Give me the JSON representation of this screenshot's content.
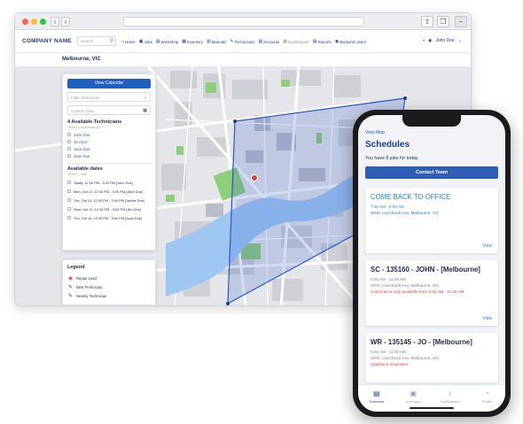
{
  "browser": {
    "company": "COMPANY NAME",
    "search_placeholder": "Search",
    "menu": [
      {
        "icon": "home-icon",
        "glyph": "⌂",
        "label": "Home"
      },
      {
        "icon": "briefcase-icon",
        "glyph": "▣",
        "label": "Jobs"
      },
      {
        "icon": "workshop-icon",
        "glyph": "▤",
        "label": "Workshop"
      },
      {
        "icon": "inventory-icon",
        "glyph": "▦",
        "label": "Inventory"
      },
      {
        "icon": "manuals-icon",
        "glyph": "▥",
        "label": "Manuals"
      },
      {
        "icon": "wrench-icon",
        "glyph": "✎",
        "label": "Technicians"
      },
      {
        "icon": "accounts-icon",
        "glyph": "▧",
        "label": "Accounts"
      },
      {
        "icon": "dashboard-icon",
        "glyph": "▦",
        "label": "Dashboards"
      },
      {
        "icon": "reports-icon",
        "glyph": "▤",
        "label": "Reports"
      },
      {
        "icon": "user-circle-icon",
        "glyph": "◉",
        "label": "Backend Users"
      }
    ],
    "user_name": "John Doe",
    "location": "Melbourne, VIC"
  },
  "panel": {
    "view_calendar": "View Calendar",
    "filter_placeholder": "Filter Technician",
    "date_placeholder": "Custom Date",
    "available_title": "4 Available Technicians",
    "available_sub": "Select a technician (if)",
    "technicians": [
      "John Doe",
      "Jim Doe",
      "Jane Doe",
      "Juan Doe"
    ],
    "dates_title": "Available dates",
    "dates_sub": "Select 1 date",
    "dates": [
      "Today, 12:30 PM - 3:00 PM [John Doe]",
      "Mon, Oct 13, 12:30 PM - 3:00 PM [Jane Doe]",
      "Tue, Oct 13, 12:30 PM - 3:00 PM [James Doe]",
      "Wed, Oct 13, 12:30 PM - 3:00 PM [Jim Doe]",
      "Thu, Oct 13, 12:30 PM - 3:00 PM [Juda Doe]"
    ]
  },
  "legend": {
    "title": "Legend",
    "items": [
      {
        "icon": "repair-lead-icon",
        "glyph": "◉",
        "color": "#d9423b",
        "label": "Repair Lead"
      },
      {
        "icon": "wrench-icon",
        "glyph": "✎",
        "color": "#1d3f8c",
        "label": "Best Technician"
      },
      {
        "icon": "wrench-icon",
        "glyph": "✎",
        "color": "#1d3f8c",
        "label": "Nearby Technician"
      }
    ]
  },
  "phone": {
    "view_map": "View Map",
    "title": "Schedules",
    "jobs_today": "You have 8 jobs for today",
    "contact_team": "Contact Team",
    "cards": [
      {
        "title": "COME BACK TO OFFICE",
        "time": "7:00 AM - 8:00 AM",
        "address": "3000, Leichhardt Ave, Melbourne, VIC",
        "note": "",
        "view": "View"
      },
      {
        "title": "SC - 135160 - JOHN - [Melbourne]",
        "time": "9:00 AM - 11:00 AM",
        "address": "3000, Leichhardt Ave, Melbourne, VIC",
        "note": "Customer is only available from 9:00 AM - 11:00 AM",
        "view": "View"
      },
      {
        "title": "WR - 135145 - JO - [Melbourne]",
        "time": "9:00 AM - 11:00 AM",
        "address": "3000, Leichhardt Ave, Melbourne, VIC",
        "note": "Appliance Inspection",
        "view": ""
      }
    ],
    "tabs": [
      {
        "icon": "schedule-icon",
        "glyph": "▤",
        "label": "Schedule",
        "active": true
      },
      {
        "icon": "inventory-icon",
        "glyph": "▣",
        "label": "Inventory",
        "active": false
      },
      {
        "icon": "bell-icon",
        "glyph": "♪",
        "label": "Notifications",
        "active": false
      },
      {
        "icon": "profile-icon",
        "glyph": "◔",
        "label": "Profile",
        "active": false
      }
    ]
  },
  "colors": {
    "accent": "#1e5fbf",
    "brand": "#1d3f8c",
    "alert": "#d9423b",
    "polygon": "#2b57c9"
  }
}
